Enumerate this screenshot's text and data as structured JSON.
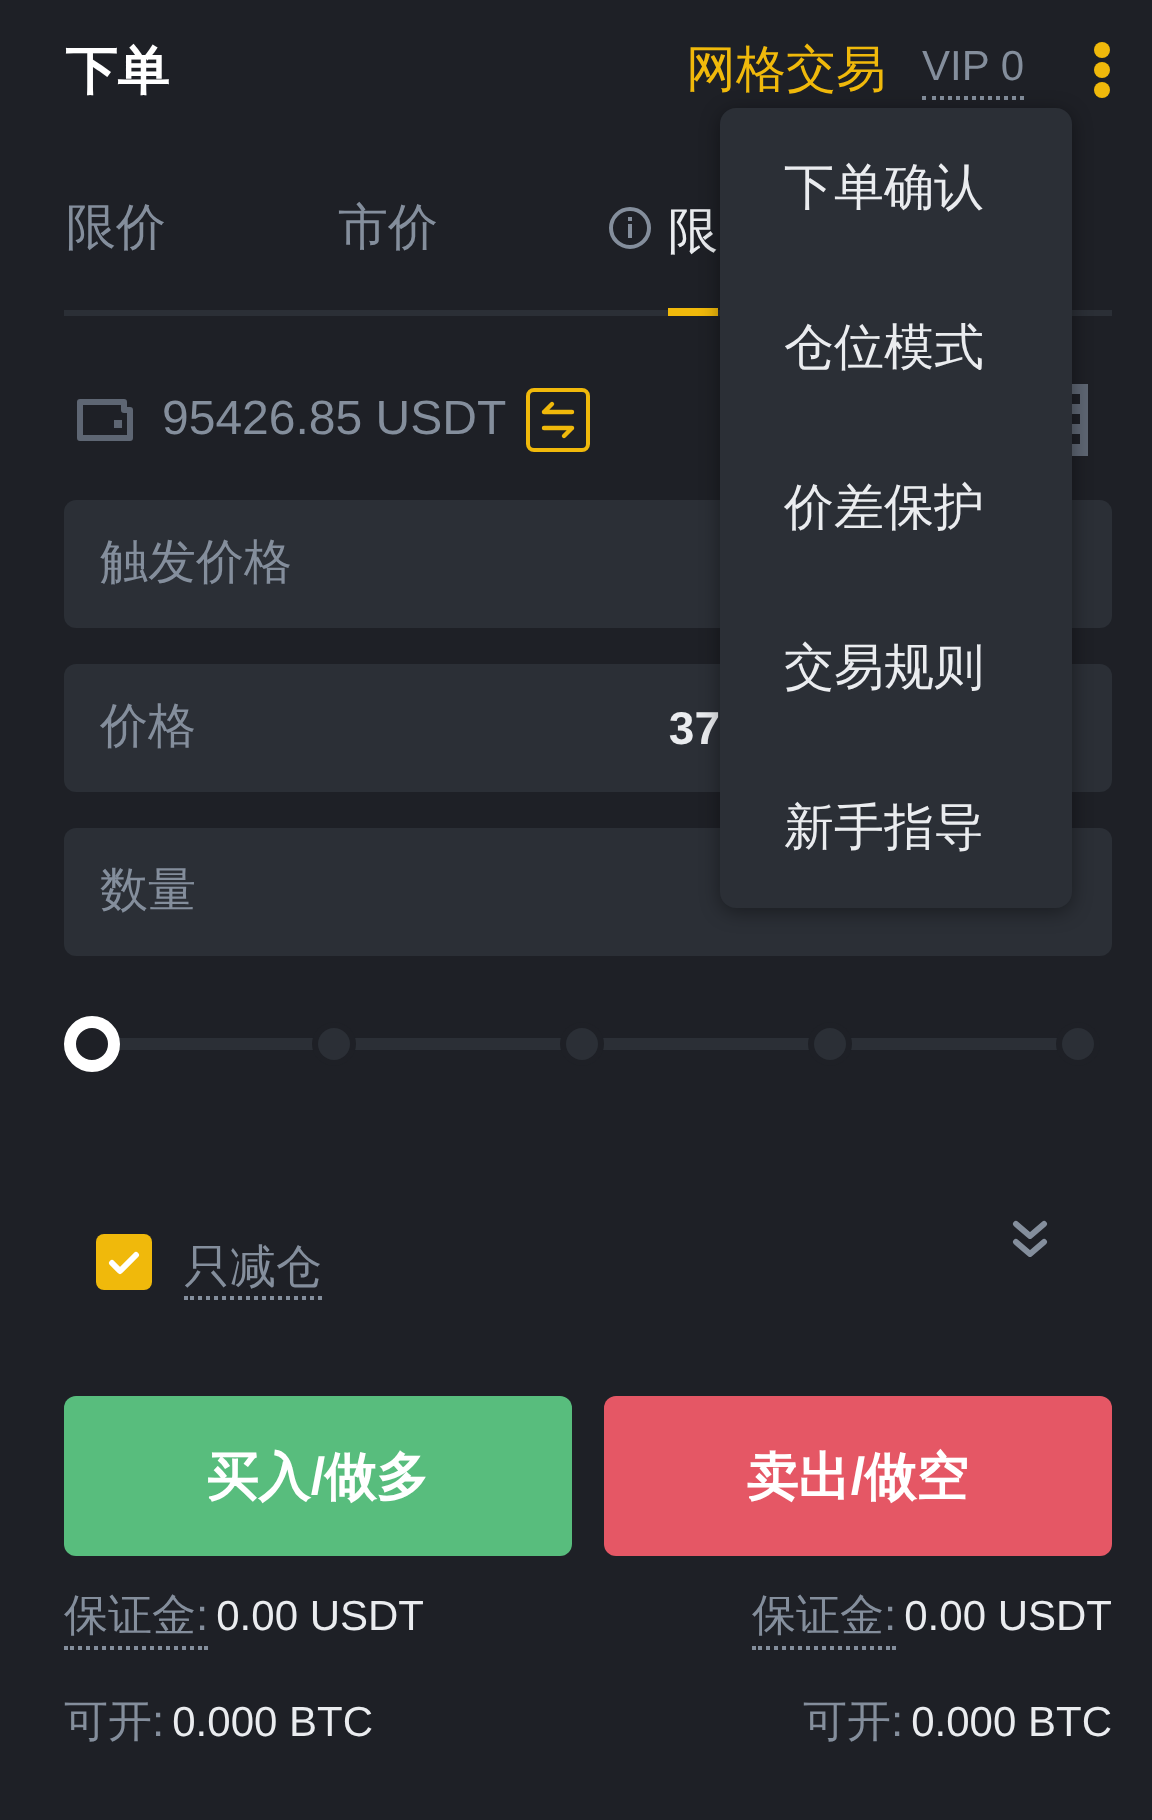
{
  "header": {
    "title": "下单",
    "grid_link": "网格交易",
    "vip": "VIP 0"
  },
  "order_tabs": [
    {
      "label": "限价",
      "selected": false,
      "info": false
    },
    {
      "label": "市价",
      "selected": false,
      "info": false
    },
    {
      "label": "限",
      "selected": true,
      "info": true
    }
  ],
  "balance": {
    "amount": "95426.85 USDT"
  },
  "fields": [
    {
      "label": "触发价格"
    },
    {
      "label": "价格",
      "value": "37"
    },
    {
      "label": "数量"
    }
  ],
  "slider": {
    "level": 0
  },
  "reduce_only": {
    "label": "只减仓",
    "checked": true
  },
  "buttons": [
    {
      "label": "买入/做多",
      "kind": "buy"
    },
    {
      "label": "卖出/做空",
      "kind": "sell"
    }
  ],
  "sides": [
    {
      "margin_label": "保证金:",
      "margin": "0.00 USDT",
      "open_label": "可开:",
      "open": "0.000 BTC"
    },
    {
      "margin_label": "保证金:",
      "margin": "0.00 USDT",
      "open_label": "可开:",
      "open": "0.000 BTC"
    }
  ],
  "menu": {
    "items": [
      "下单确认",
      "仓位模式",
      "价差保护",
      "交易规则",
      "新手指导"
    ]
  }
}
